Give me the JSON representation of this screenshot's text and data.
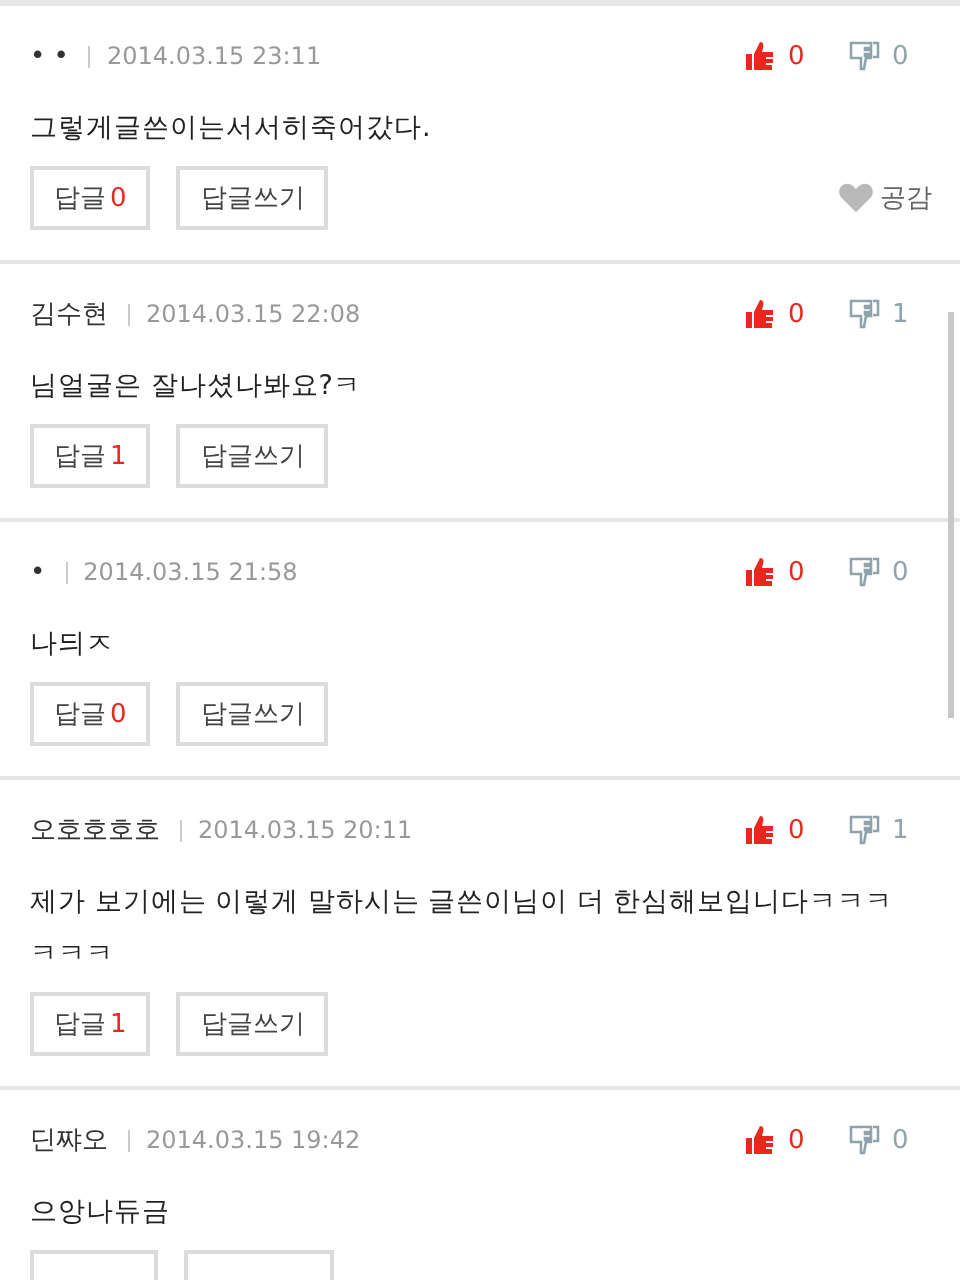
{
  "comments": [
    {
      "author": "• •",
      "date": "2014.03.15 23:11",
      "likes": "0",
      "dislikes": "0",
      "text": "그렇게글쓴이는서서히죽어갔다.",
      "reply_label": "답글",
      "reply_count": "0",
      "write_label": "답글쓰기",
      "empathy": "공감"
    },
    {
      "author": "김수현",
      "date": "2014.03.15 22:08",
      "likes": "0",
      "dislikes": "1",
      "text": "님얼굴은 잘나셨나봐요?ㅋ",
      "reply_label": "답글",
      "reply_count": "1",
      "write_label": "답글쓰기"
    },
    {
      "author": "•",
      "date": "2014.03.15 21:58",
      "likes": "0",
      "dislikes": "0",
      "text": "나듸ㅈ",
      "reply_label": "답글",
      "reply_count": "0",
      "write_label": "답글쓰기"
    },
    {
      "author": "오호호호호",
      "date": "2014.03.15 20:11",
      "likes": "0",
      "dislikes": "1",
      "text": "제가 보기에는 이렇게 말하시는 글쓴이님이 더 한심해보입니다ㅋㅋㅋㅋㅋㅋ",
      "reply_label": "답글",
      "reply_count": "1",
      "write_label": "답글쓰기"
    },
    {
      "author": "딘쨔오",
      "date": "2014.03.15 19:42",
      "likes": "0",
      "dislikes": "0",
      "text": "으앙나듀금"
    }
  ]
}
